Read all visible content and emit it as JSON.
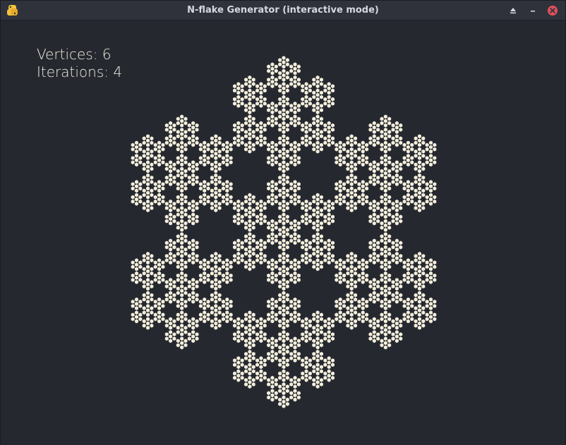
{
  "window": {
    "title": "N-flake Generator (interactive mode)",
    "icons": {
      "app": "python-icon",
      "eject": "eject-icon",
      "minimize": "minimize-icon",
      "close": "close-icon"
    },
    "colors": {
      "background": "#262830",
      "titlebar": "#2f323b",
      "close": "#e0505a"
    }
  },
  "info": {
    "vertices_label": "Vertices:",
    "vertices_value": "6",
    "iterations_label": "Iterations:",
    "iterations_value": "4"
  },
  "fractal": {
    "type": "n-flake",
    "vertices": 6,
    "iterations": 4,
    "fill_color": "#f3efdc"
  }
}
